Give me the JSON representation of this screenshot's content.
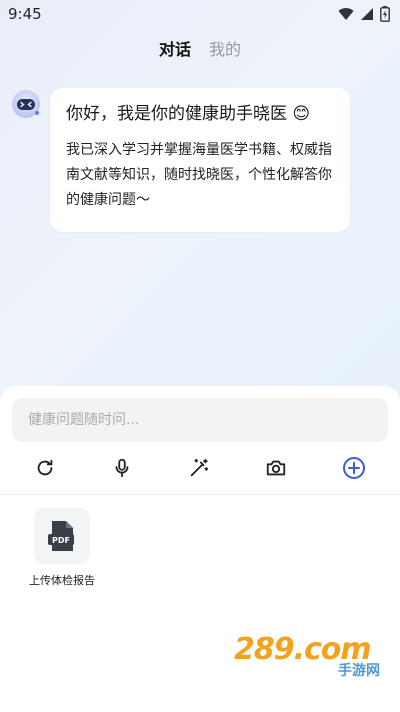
{
  "status_bar": {
    "time": "9:45"
  },
  "tabs": [
    {
      "label": "对话",
      "active": true
    },
    {
      "label": "我的",
      "active": false
    }
  ],
  "message": {
    "title": "你好，我是你的健康助手晓医 😊",
    "body": "我已深入学习并掌握海量医学书籍、权威指南文献等知识，随时找晓医，个性化解答你的健康问题～"
  },
  "composer": {
    "placeholder": "健康问题随时问..."
  },
  "toolbar": {
    "icons": [
      "refresh-icon",
      "microphone-icon",
      "magic-wand-icon",
      "camera-icon",
      "add-circle-icon"
    ]
  },
  "upload": {
    "icon_text": "PDF",
    "label": "上传体检报告"
  },
  "watermark": {
    "main": "289.com",
    "sub": "手游网"
  },
  "colors": {
    "accent": "#3b5bdb",
    "watermark_orange": "#f2a31b",
    "watermark_blue": "#4b9ad8"
  }
}
